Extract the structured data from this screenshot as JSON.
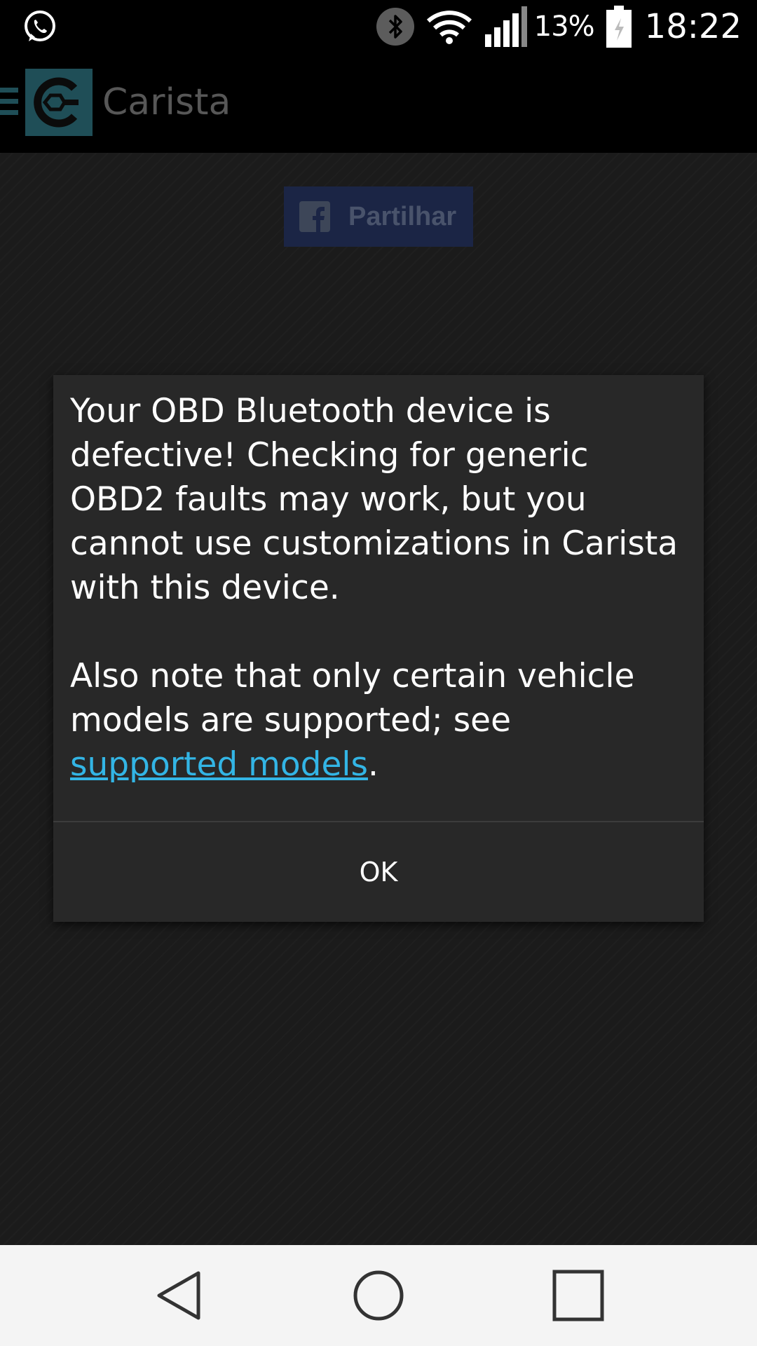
{
  "status_bar": {
    "notification_icon": "whatsapp-icon",
    "icons": [
      "bluetooth-icon",
      "wifi-icon",
      "signal-icon"
    ],
    "battery_percent": "13%",
    "battery_icon": "battery-charging-icon",
    "time": "18:22"
  },
  "app_bar": {
    "title": "Carista",
    "menu_icon": "hamburger-icon",
    "logo": "carista-logo"
  },
  "share_button": {
    "label": "Partilhar",
    "icon": "facebook-icon",
    "bg_color": "#1b2545"
  },
  "dialog": {
    "paragraph1": "Your OBD Bluetooth device is defective! Checking for generic OBD2 faults may work, but you cannot use customizations in Carista with this device.",
    "paragraph2_prefix": "Also note that only certain vehicle models are supported; see ",
    "link_text": "supported models",
    "paragraph2_suffix": ".",
    "ok_label": "OK",
    "link_color": "#33b5e5"
  },
  "nav_bar": {
    "buttons": [
      "back-icon",
      "home-icon",
      "recents-icon"
    ]
  }
}
